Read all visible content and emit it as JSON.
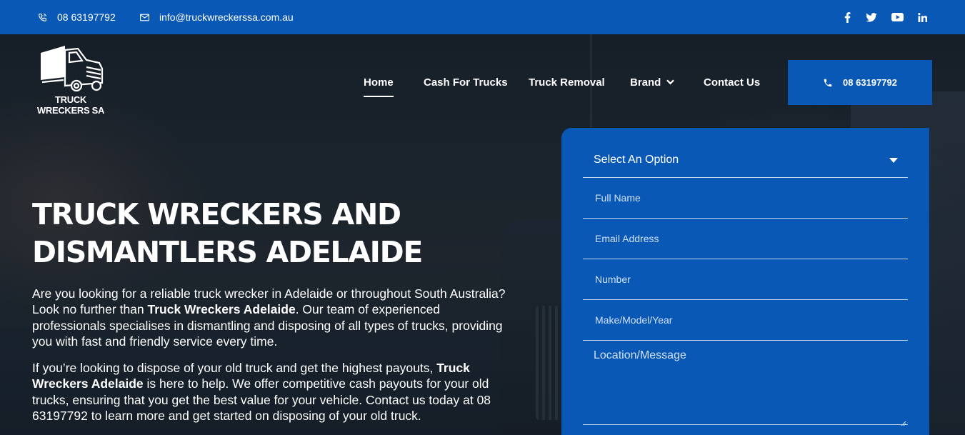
{
  "topbar": {
    "phone": "08 63197792",
    "email": "info@truckwreckerssa.com.au",
    "social_icons": [
      "facebook-icon",
      "twitter-icon",
      "youtube-icon",
      "linkedin-icon"
    ]
  },
  "logo": {
    "text": "TRUCK WRECKERS SA"
  },
  "nav": {
    "items": [
      {
        "label": "Home",
        "active": true
      },
      {
        "label": "Cash For Trucks"
      },
      {
        "label": "Truck Removal"
      },
      {
        "label": "Brand",
        "has_dropdown": true
      },
      {
        "label": "Contact Us"
      }
    ],
    "call_button": "08 63197792"
  },
  "hero": {
    "heading": "TRUCK WRECKERS AND DISMANTLERS ADELAIDE",
    "p1_a": "Are you looking for a reliable truck wrecker in Adelaide or throughout South Australia? Look no further than ",
    "p1_b": "Truck Wreckers Adelaide",
    "p1_c": ". Our team of experienced professionals specialises in dismantling and disposing of all types of trucks, providing you with fast and friendly service every time.",
    "p2_a": "If you’re looking to dispose of your old truck and get the highest payouts, ",
    "p2_b": "Truck Wreckers Adelaide",
    "p2_c": " is here to help. We offer competitive cash payouts for your old trucks, ensuring that you get the best value for your vehicle. Contact us today at 08 63197792 to learn more and get started on disposing of your old truck."
  },
  "form": {
    "select": "Select An Option",
    "full_name": "Full Name",
    "email": "Email Address",
    "number": "Number",
    "make": "Make/Model/Year",
    "message": "Location/Message"
  },
  "colors": {
    "brand_blue": "#0a58b5",
    "text": "#ffffff"
  }
}
